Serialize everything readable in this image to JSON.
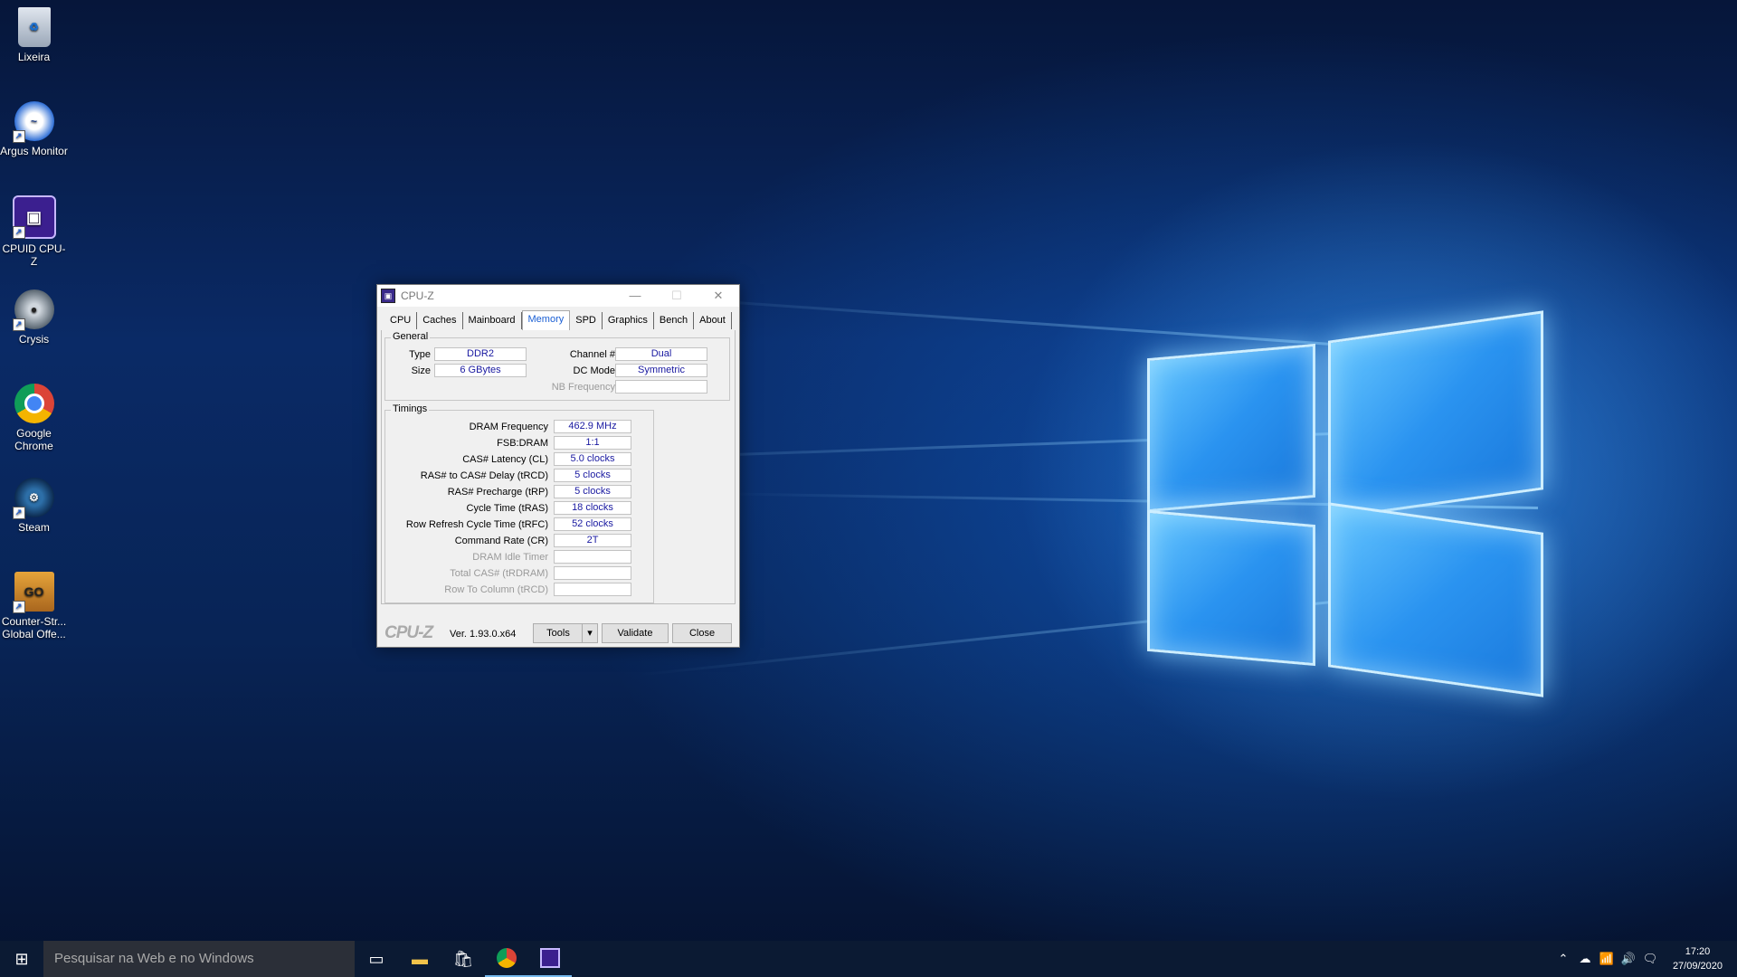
{
  "desktop": {
    "icons": [
      {
        "label": "Lixeira",
        "icon": "recycle-bin-icon"
      },
      {
        "label": "Argus Monitor",
        "icon": "argus-monitor-icon"
      },
      {
        "label": "CPUID CPU-Z",
        "icon": "cpu-z-icon"
      },
      {
        "label": "Crysis",
        "icon": "crysis-icon"
      },
      {
        "label": "Google Chrome",
        "icon": "chrome-icon"
      },
      {
        "label": "Steam",
        "icon": "steam-icon"
      },
      {
        "label": "Counter-Str... Global Offe...",
        "icon": "csgo-icon"
      }
    ]
  },
  "window": {
    "title": "CPU-Z",
    "tabs": [
      "CPU",
      "Caches",
      "Mainboard",
      "Memory",
      "SPD",
      "Graphics",
      "Bench",
      "About"
    ],
    "active_tab": "Memory",
    "general": {
      "legend": "General",
      "type_label": "Type",
      "type_value": "DDR2",
      "size_label": "Size",
      "size_value": "6 GBytes",
      "channel_label": "Channel #",
      "channel_value": "Dual",
      "dcmode_label": "DC Mode",
      "dcmode_value": "Symmetric",
      "nbfreq_label": "NB Frequency",
      "nbfreq_value": ""
    },
    "timings": {
      "legend": "Timings",
      "rows": [
        {
          "label": "DRAM Frequency",
          "value": "462.9 MHz",
          "dim": false
        },
        {
          "label": "FSB:DRAM",
          "value": "1:1",
          "dim": false
        },
        {
          "label": "CAS# Latency (CL)",
          "value": "5.0 clocks",
          "dim": false
        },
        {
          "label": "RAS# to CAS# Delay (tRCD)",
          "value": "5 clocks",
          "dim": false
        },
        {
          "label": "RAS# Precharge (tRP)",
          "value": "5 clocks",
          "dim": false
        },
        {
          "label": "Cycle Time (tRAS)",
          "value": "18 clocks",
          "dim": false
        },
        {
          "label": "Row Refresh Cycle Time (tRFC)",
          "value": "52 clocks",
          "dim": false
        },
        {
          "label": "Command Rate (CR)",
          "value": "2T",
          "dim": false
        },
        {
          "label": "DRAM Idle Timer",
          "value": "",
          "dim": true
        },
        {
          "label": "Total CAS# (tRDRAM)",
          "value": "",
          "dim": true
        },
        {
          "label": "Row To Column (tRCD)",
          "value": "",
          "dim": true
        }
      ]
    },
    "footer": {
      "logo": "CPU-Z",
      "version": "Ver. 1.93.0.x64",
      "tools_label": "Tools",
      "validate_label": "Validate",
      "close_label": "Close"
    }
  },
  "taskbar": {
    "search_placeholder": "Pesquisar na Web e no Windows",
    "time": "17:20",
    "date": "27/09/2020"
  }
}
